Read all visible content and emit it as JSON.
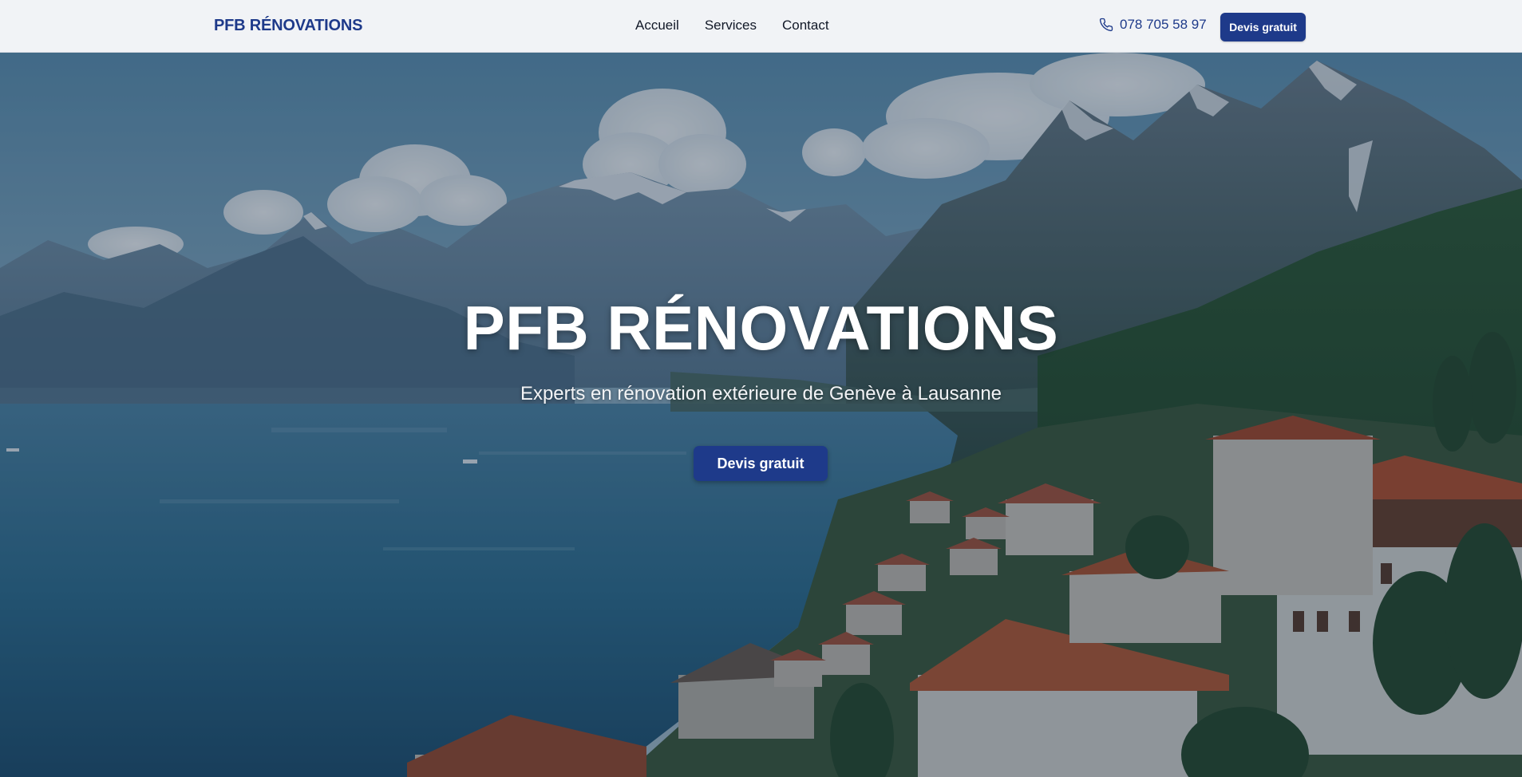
{
  "navbar": {
    "brand": "PFB RÉNOVATIONS",
    "links": [
      {
        "label": "Accueil"
      },
      {
        "label": "Services"
      },
      {
        "label": "Contact"
      }
    ],
    "phone_icon": "phone-icon",
    "phone": "078 705 58 97",
    "cta_label": "Devis gratuit"
  },
  "hero": {
    "title": "PFB RÉNOVATIONS",
    "subtitle": "Experts en rénovation extérieure de Genève à Lausanne",
    "cta_label": "Devis gratuit"
  },
  "colors": {
    "brand_blue": "#1e3a8a",
    "navbar_bg": "#f1f3f6",
    "hero_text": "#ffffff"
  }
}
